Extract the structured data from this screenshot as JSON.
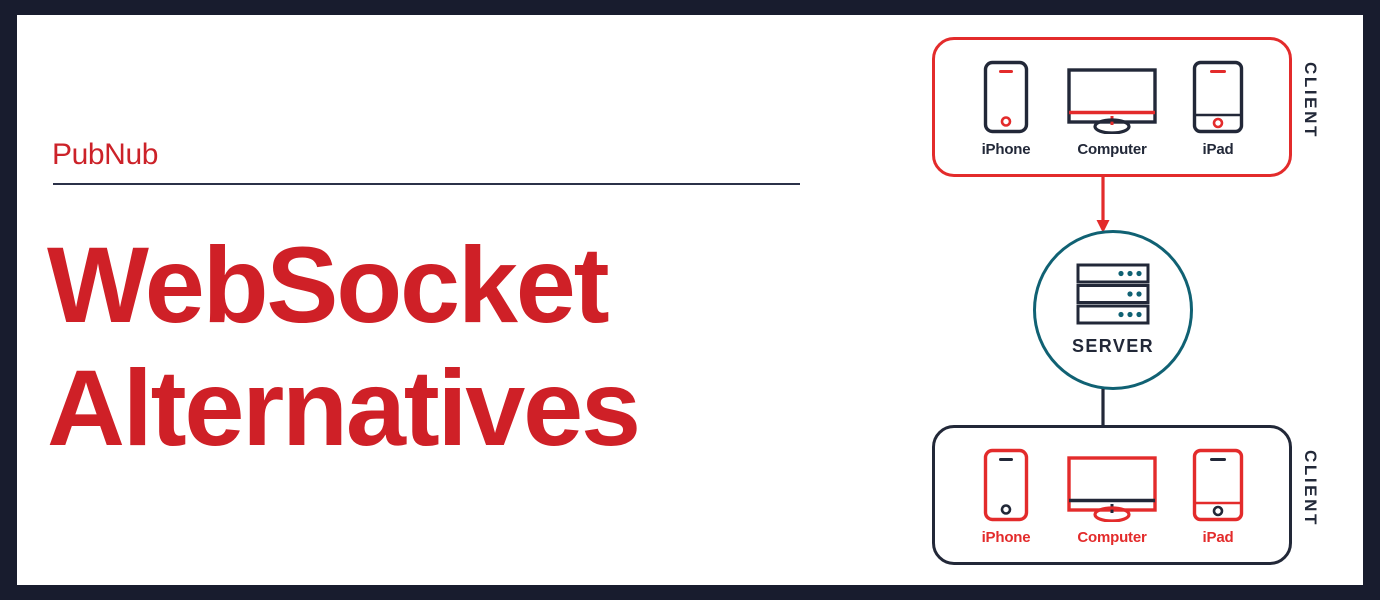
{
  "frame": {
    "border_color": "#181C2E",
    "canvas_color": "#FFFFFF"
  },
  "brand": {
    "name": "PubNub",
    "color": "#CC2229"
  },
  "headline": {
    "line1": "WebSocket",
    "line2": "Alternatives",
    "color": "#CF2027"
  },
  "diagram": {
    "accent_red": "#E32B2B",
    "accent_navy": "#222838",
    "accent_teal": "#106173",
    "client_top": {
      "label": "CLIENT",
      "border_color": "#E32B2B",
      "devices": [
        {
          "icon": "iphone-icon",
          "label": "iPhone"
        },
        {
          "icon": "computer-icon",
          "label": "Computer"
        },
        {
          "icon": "ipad-icon",
          "label": "iPad"
        }
      ]
    },
    "server": {
      "label": "SERVER",
      "icon": "server-rack-icon",
      "circle_color": "#106173",
      "rack_dots": [
        3,
        2,
        3
      ]
    },
    "client_bottom": {
      "label": "CLIENT",
      "border_color": "#222838",
      "devices": [
        {
          "icon": "iphone-icon",
          "label": "iPhone"
        },
        {
          "icon": "computer-icon",
          "label": "Computer"
        },
        {
          "icon": "ipad-icon",
          "label": "iPad"
        }
      ]
    },
    "arrows": [
      {
        "name": "client-to-server-arrow",
        "color": "#E32B2B",
        "direction": "down"
      },
      {
        "name": "server-to-client-arrow",
        "color": "#222838",
        "direction": "down"
      }
    ]
  }
}
